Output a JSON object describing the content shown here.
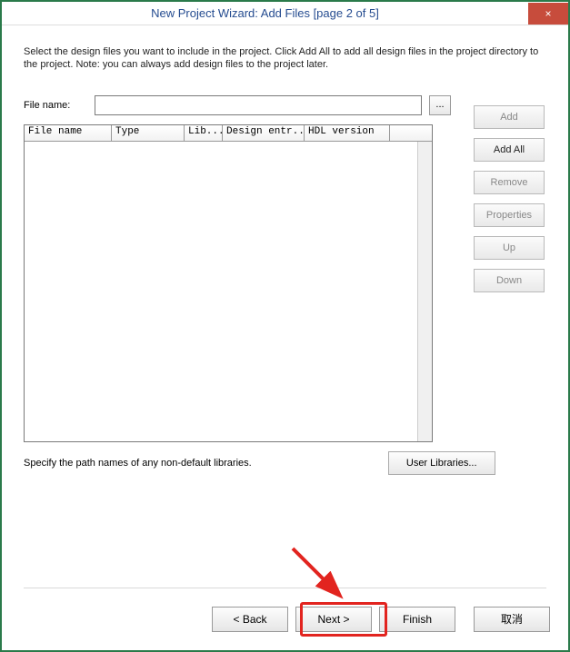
{
  "titlebar": {
    "title": "New Project Wizard: Add Files [page 2 of 5]",
    "close_icon": "×"
  },
  "instructions": "Select the design files you want to include in the project. Click Add All to add all design files in the project directory to the project. Note: you can always add design files to the project later.",
  "file_row": {
    "label": "File name:",
    "input_value": "",
    "browse_label": "..."
  },
  "side_buttons": {
    "add": "Add",
    "add_all": "Add All",
    "remove": "Remove",
    "properties": "Properties",
    "up": "Up",
    "down": "Down"
  },
  "table": {
    "columns": [
      "File name",
      "Type",
      "Lib...",
      "Design entr...",
      "HDL version",
      ""
    ],
    "rows": []
  },
  "library": {
    "text": "Specify the path names of any non-default libraries.",
    "button": "User Libraries..."
  },
  "nav": {
    "back": "< Back",
    "next": "Next >",
    "finish": "Finish",
    "cancel": "取消"
  }
}
